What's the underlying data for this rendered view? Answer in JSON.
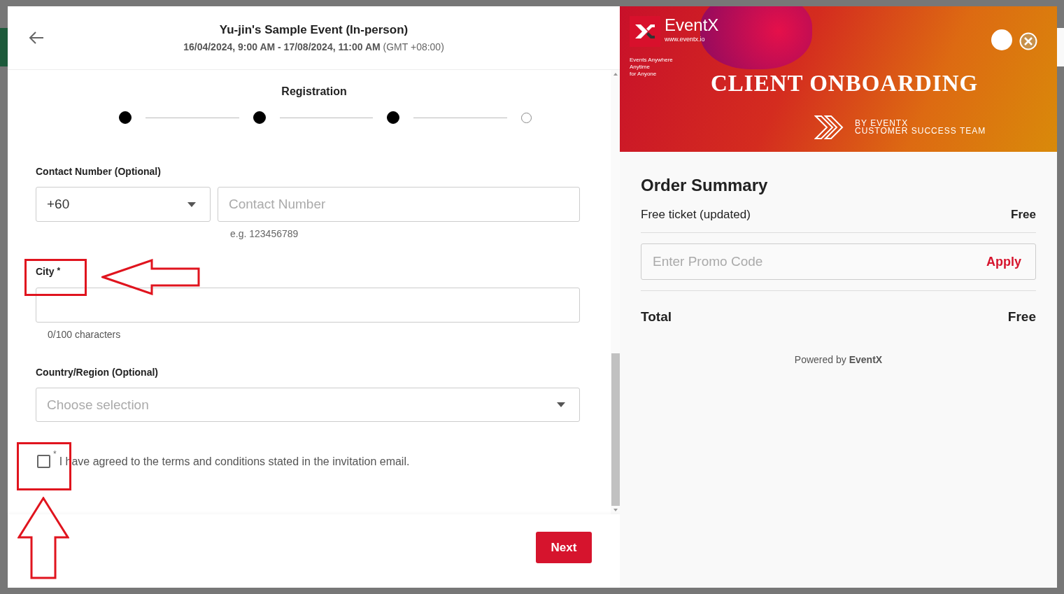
{
  "header": {
    "title": "Yu-jin's Sample Event (In-person)",
    "dates": "16/04/2024, 9:00 AM - 17/08/2024, 11:00 AM",
    "timezone": "(GMT +08:00)"
  },
  "step_title": "Registration",
  "steps": [
    {
      "completed": true
    },
    {
      "completed": true
    },
    {
      "completed": true
    },
    {
      "completed": false
    }
  ],
  "contact": {
    "label": "Contact Number (Optional)",
    "country_code": "+60",
    "placeholder": "Contact Number",
    "hint": "e.g. 123456789"
  },
  "city": {
    "label": "City",
    "required_mark": "*",
    "counter": "0/100 characters"
  },
  "country": {
    "label": "Country/Region (Optional)",
    "placeholder": "Choose selection"
  },
  "terms": {
    "checked": false,
    "required_mark": "*",
    "text": "I have agreed to the terms and conditions stated in the invitation email."
  },
  "next_button": "Next",
  "banner": {
    "logo": "EventX",
    "url": "www.eventx.io",
    "tagline": [
      "Events Anywhere",
      "Anytime",
      "for Anyone"
    ],
    "heading": "CLIENT ONBOARDING",
    "byline": [
      "BY EVENTX",
      "CUSTOMER SUCCESS TEAM"
    ]
  },
  "order_summary": {
    "title": "Order Summary",
    "items": [
      {
        "name": "Free ticket (updated)",
        "price": "Free"
      }
    ],
    "promo_placeholder": "Enter Promo Code",
    "apply": "Apply",
    "total_label": "Total",
    "total": "Free",
    "powered_by": "Powered by",
    "brand": "EventX"
  }
}
